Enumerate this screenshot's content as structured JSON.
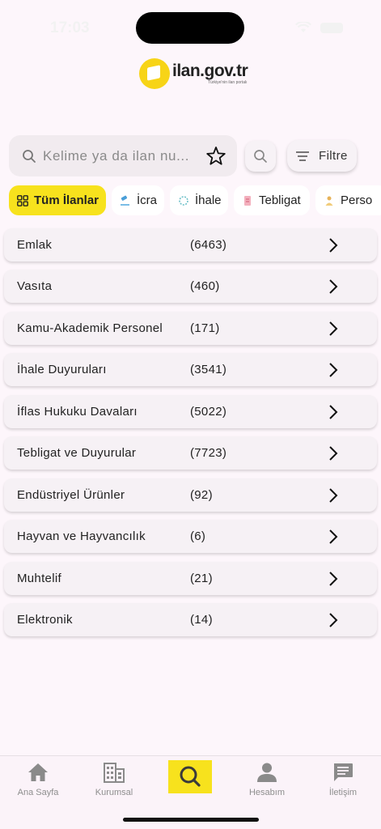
{
  "status_bar": {
    "time": "17:03"
  },
  "logo": {
    "name": "ilan.gov.tr",
    "tagline": "Türkiye'nin ilan portalı"
  },
  "search": {
    "placeholder": "Kelime ya da ilan nu..."
  },
  "filter": {
    "label": "Filtre"
  },
  "chips": [
    {
      "label": "Tüm İlanlar",
      "icon": "grid-icon",
      "active": true
    },
    {
      "label": "İcra",
      "icon": "gavel-icon",
      "active": false
    },
    {
      "label": "İhale",
      "icon": "auction-icon",
      "active": false
    },
    {
      "label": "Tebligat",
      "icon": "document-icon",
      "active": false
    },
    {
      "label": "Perso",
      "icon": "person-icon",
      "active": false
    }
  ],
  "categories": [
    {
      "label": "Emlak",
      "count": "(6463)"
    },
    {
      "label": "Vasıta",
      "count": "(460)"
    },
    {
      "label": "Kamu-Akademik Personel",
      "count": "(171)"
    },
    {
      "label": "İhale Duyuruları",
      "count": "(3541)"
    },
    {
      "label": "İflas Hukuku Davaları",
      "count": "(5022)"
    },
    {
      "label": "Tebligat ve Duyurular",
      "count": "(7723)"
    },
    {
      "label": "Endüstriyel Ürünler",
      "count": "(92)"
    },
    {
      "label": "Hayvan ve Hayvancılık",
      "count": "(6)"
    },
    {
      "label": "Muhtelif",
      "count": "(21)"
    },
    {
      "label": "Elektronik",
      "count": "(14)"
    }
  ],
  "bottom_nav": [
    {
      "label": "Ana Sayfa",
      "icon": "home-icon"
    },
    {
      "label": "Kurumsal",
      "icon": "building-icon"
    },
    {
      "label": "",
      "icon": "search-icon"
    },
    {
      "label": "Hesabım",
      "icon": "account-icon"
    },
    {
      "label": "İletişim",
      "icon": "chat-icon"
    }
  ],
  "colors": {
    "accent": "#f7e21d",
    "background": "#fdf6fb",
    "logo": "#f7d417"
  }
}
